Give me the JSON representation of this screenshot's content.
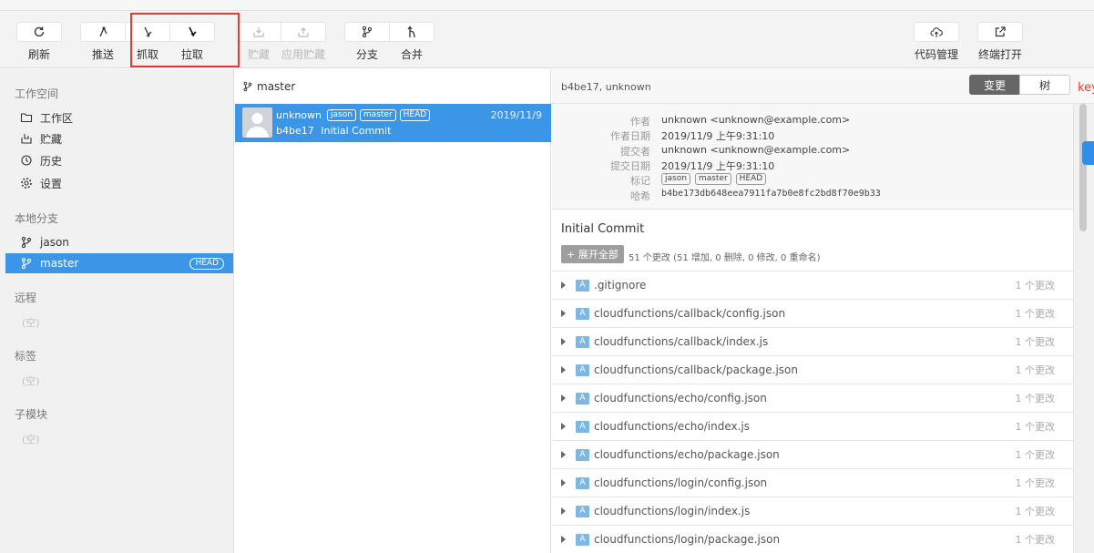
{
  "toolbar": {
    "refresh": "刷新",
    "push": "推送",
    "fetch": "抓取",
    "pull": "拉取",
    "stash": "贮藏",
    "apply_stash": "应用贮藏",
    "branch": "分支",
    "merge": "合并",
    "code_manage": "代码管理",
    "terminal_open": "终端打开"
  },
  "sidebar": {
    "workspace_title": "工作空间",
    "workspace_items": [
      "工作区",
      "贮藏",
      "历史",
      "设置"
    ],
    "local_branches_title": "本地分支",
    "branches": [
      {
        "name": "jason",
        "selected": false
      },
      {
        "name": "master",
        "selected": true,
        "badge": "HEAD"
      }
    ],
    "remote_title": "远程",
    "remote_empty": "(空)",
    "tags_title": "标签",
    "tags_empty": "(空)",
    "submodules_title": "子模块",
    "submodules_empty": "(空)"
  },
  "history": {
    "branch": "master",
    "commits": [
      {
        "author": "unknown",
        "tags": [
          "jason",
          "master",
          "HEAD"
        ],
        "date": "2019/11/9",
        "hash_short": "b4be17",
        "message": "Initial Commit"
      }
    ]
  },
  "detail": {
    "header": "b4be17, unknown",
    "seg_changes": "变更",
    "seg_tree": "树",
    "meta": {
      "author_label": "作者",
      "author_value": "unknown <unknown@example.com>",
      "author_date_label": "作者日期",
      "author_date_value": "2019/11/9 上午9:31:10",
      "committer_label": "提交者",
      "committer_value": "unknown <unknown@example.com>",
      "commit_date_label": "提交日期",
      "commit_date_value": "2019/11/9 上午9:31:10",
      "tags_label": "标记",
      "tags": [
        "jason",
        "master",
        "HEAD"
      ],
      "hash_label": "哈希",
      "hash_value": "b4be173db648eea7911fa7b0e8fc2bd8f70e9b33"
    },
    "commit_title": "Initial Commit",
    "expand_all": "+ 展开全部",
    "summary": "51 个更改 (51 增加, 0 删除, 0 修改, 0 重命名)",
    "files": [
      {
        "status": "A",
        "name": ".gitignore",
        "changes": "1 个更改"
      },
      {
        "status": "A",
        "name": "cloudfunctions/callback/config.json",
        "changes": "1 个更改"
      },
      {
        "status": "A",
        "name": "cloudfunctions/callback/index.js",
        "changes": "1 个更改"
      },
      {
        "status": "A",
        "name": "cloudfunctions/callback/package.json",
        "changes": "1 个更改"
      },
      {
        "status": "A",
        "name": "cloudfunctions/echo/config.json",
        "changes": "1 个更改"
      },
      {
        "status": "A",
        "name": "cloudfunctions/echo/index.js",
        "changes": "1 个更改"
      },
      {
        "status": "A",
        "name": "cloudfunctions/echo/package.json",
        "changes": "1 个更改"
      },
      {
        "status": "A",
        "name": "cloudfunctions/login/config.json",
        "changes": "1 个更改"
      },
      {
        "status": "A",
        "name": "cloudfunctions/login/index.js",
        "changes": "1 个更改"
      },
      {
        "status": "A",
        "name": "cloudfunctions/login/package.json",
        "changes": "1 个更改"
      }
    ]
  },
  "edge": {
    "red_text": "key"
  },
  "colors": {
    "selection": "#3c96e8",
    "highlight_box": "#e53935",
    "added_badge": "#7fb7e3"
  }
}
